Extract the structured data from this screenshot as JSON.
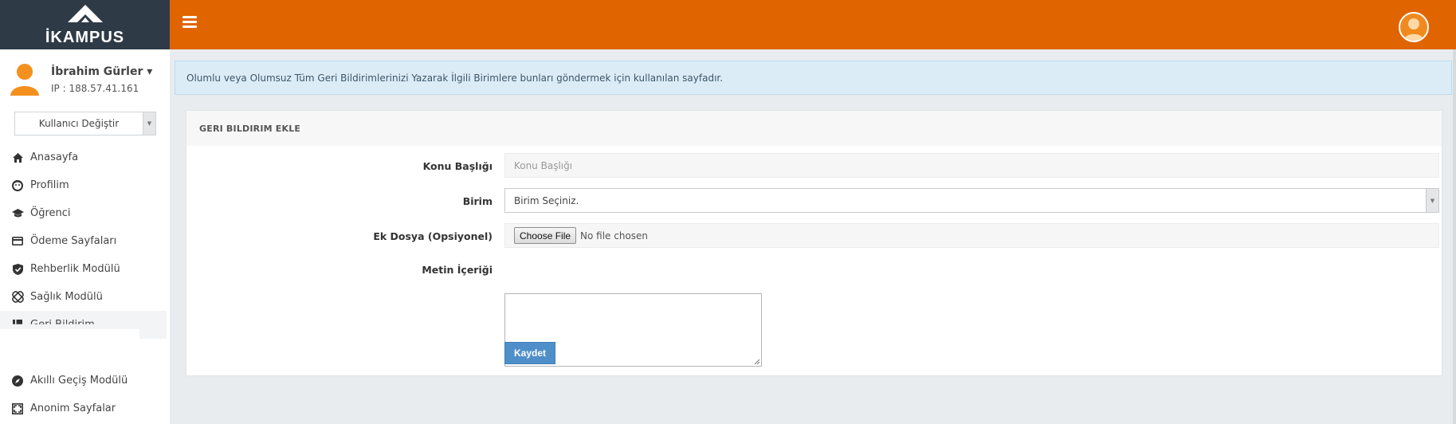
{
  "brand": {
    "name": "İKAMPUS"
  },
  "topbar": {
    "menu_icon": "hamburger-icon",
    "avatar_icon": "user-avatar-icon",
    "color": "#e06400"
  },
  "user": {
    "name": "İbrahim Gürler",
    "caret": "▾",
    "ip": "IP : 188.57.41.161"
  },
  "user_switch": {
    "label": "Kullanıcı Değiştir",
    "arrow": "▼"
  },
  "sidebar": {
    "items": [
      {
        "label": "Anasayfa",
        "icon": "home-icon"
      },
      {
        "label": "Profilim",
        "icon": "profile-face-icon"
      },
      {
        "label": "Öğrenci",
        "icon": "graduation-cap-icon"
      },
      {
        "label": "Ödeme Sayfaları",
        "icon": "credit-card-icon"
      },
      {
        "label": "Rehberlik Modülü",
        "icon": "shield-check-icon"
      },
      {
        "label": "Sağlık Modülü",
        "icon": "bandage-icon"
      },
      {
        "label": "Geri Bildirim",
        "icon": "book-icon"
      },
      {
        "label": "Akıllı Geçiş Modülü",
        "icon": "compass-icon"
      },
      {
        "label": "Anonim Sayfalar",
        "icon": "expand-icon"
      }
    ]
  },
  "info": {
    "text": "Olumlu veya Olumsuz Tüm Geri Bildirimlerinizi Yazarak İlgili Birimlere bunları göndermek için kullanılan sayfadır."
  },
  "form": {
    "title": "GERI BILDIRIM EKLE",
    "subject_label": "Konu Başlığı",
    "subject_placeholder": "Konu Başlığı",
    "unit_label": "Birim",
    "unit_selected": "Birim Seçiniz.",
    "attachment_label": "Ek Dosya (Opsiyonel)",
    "file_button": "Choose File",
    "file_status": "No file chosen",
    "content_label": "Metin İçeriği",
    "content_value": "",
    "save_label": "Kaydet"
  }
}
